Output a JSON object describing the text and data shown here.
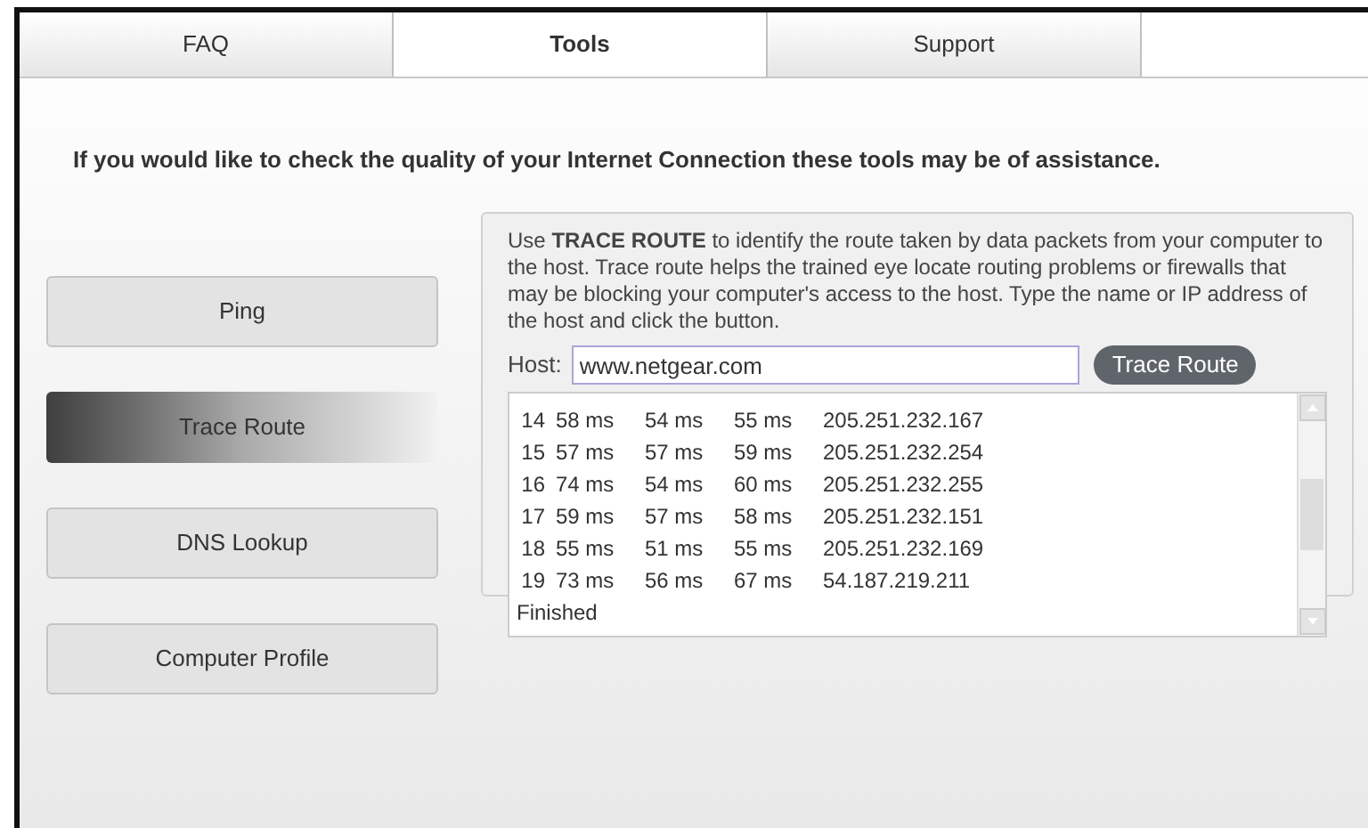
{
  "tabs": [
    {
      "label": "FAQ",
      "selected": false
    },
    {
      "label": "Tools",
      "selected": true
    },
    {
      "label": "Support",
      "selected": false
    }
  ],
  "intro": "If you would like to check the quality of your Internet Connection these tools may be of assistance.",
  "tools": [
    {
      "label": "Ping",
      "selected": false
    },
    {
      "label": "Trace Route",
      "selected": true
    },
    {
      "label": "DNS Lookup",
      "selected": false
    },
    {
      "label": "Computer Profile",
      "selected": false
    }
  ],
  "description": "Use **TRACE ROUTE** to identify the route taken by data packets from your computer to the host. Trace route helps the trained eye locate routing problems or firewalls that may be blocking your computer's access to the host. Type the name or IP address of the host and click the button.",
  "host": {
    "label": "Host:",
    "value": "www.netgear.com"
  },
  "run_button": "Trace Route",
  "results": [
    [
      "14",
      "58 ms",
      "54 ms",
      "55 ms",
      "205.251.232.167"
    ],
    [
      "15",
      "57 ms",
      "57 ms",
      "59 ms",
      "205.251.232.254"
    ],
    [
      "16",
      "74 ms",
      "54 ms",
      "60 ms",
      "205.251.232.255"
    ],
    [
      "17",
      "59 ms",
      "57 ms",
      "58 ms",
      "205.251.232.151"
    ],
    [
      "18",
      "55 ms",
      "51 ms",
      "55 ms",
      "205.251.232.169"
    ],
    [
      "19",
      "73 ms",
      "56 ms",
      "67 ms",
      "54.187.219.211"
    ]
  ],
  "status": "Finished"
}
